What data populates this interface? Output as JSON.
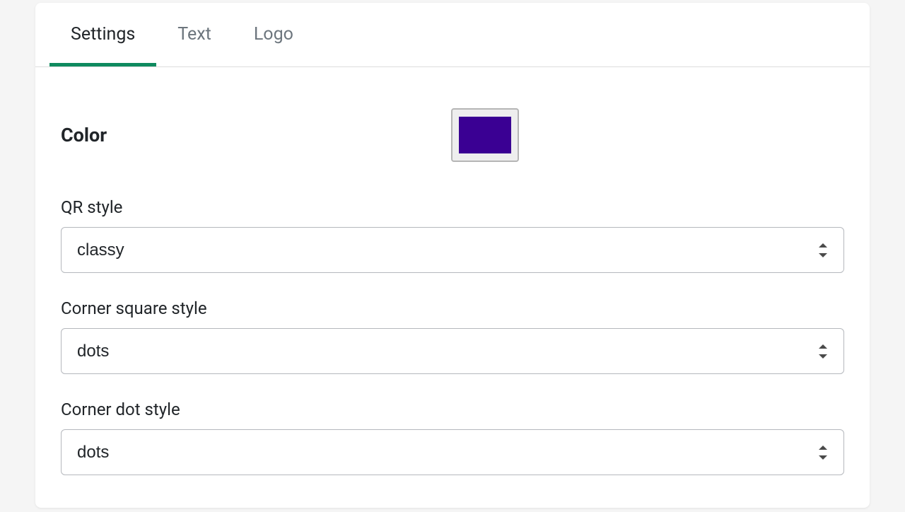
{
  "tabs": {
    "settings": "Settings",
    "text": "Text",
    "logo": "Logo",
    "active": "settings"
  },
  "color": {
    "label": "Color",
    "value": "#3a0093"
  },
  "qr_style": {
    "label": "QR style",
    "value": "classy"
  },
  "corner_square_style": {
    "label": "Corner square style",
    "value": "dots"
  },
  "corner_dot_style": {
    "label": "Corner dot style",
    "value": "dots"
  }
}
